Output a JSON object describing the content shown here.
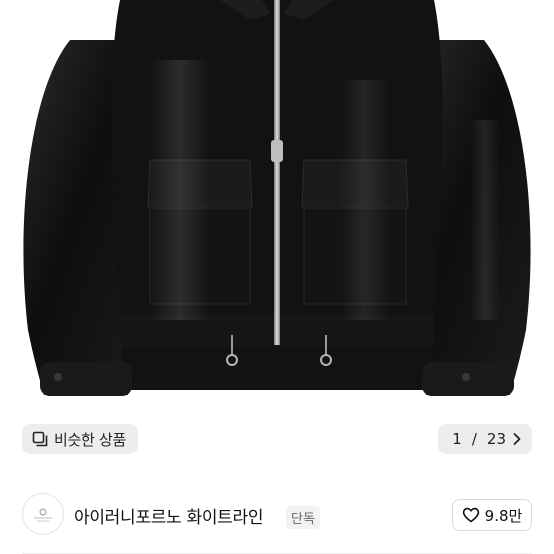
{
  "product": {
    "image_alt": "black leather zip-up jacket",
    "similar_label": "비슷한 상품",
    "counter_current": "1",
    "counter_total": "23",
    "icons": {
      "similar": "similar-products-icon",
      "next": "chevron-right-icon"
    }
  },
  "shop": {
    "name": "아이러니포르노 화이트라인",
    "tag": "단독",
    "likes": "9.8만",
    "icons": {
      "logo": "shop-logo",
      "like": "heart-outline-icon"
    }
  },
  "colors": {
    "pill_bg": "#ececec",
    "text": "#111111",
    "tag_bg": "#f2f2f2"
  }
}
